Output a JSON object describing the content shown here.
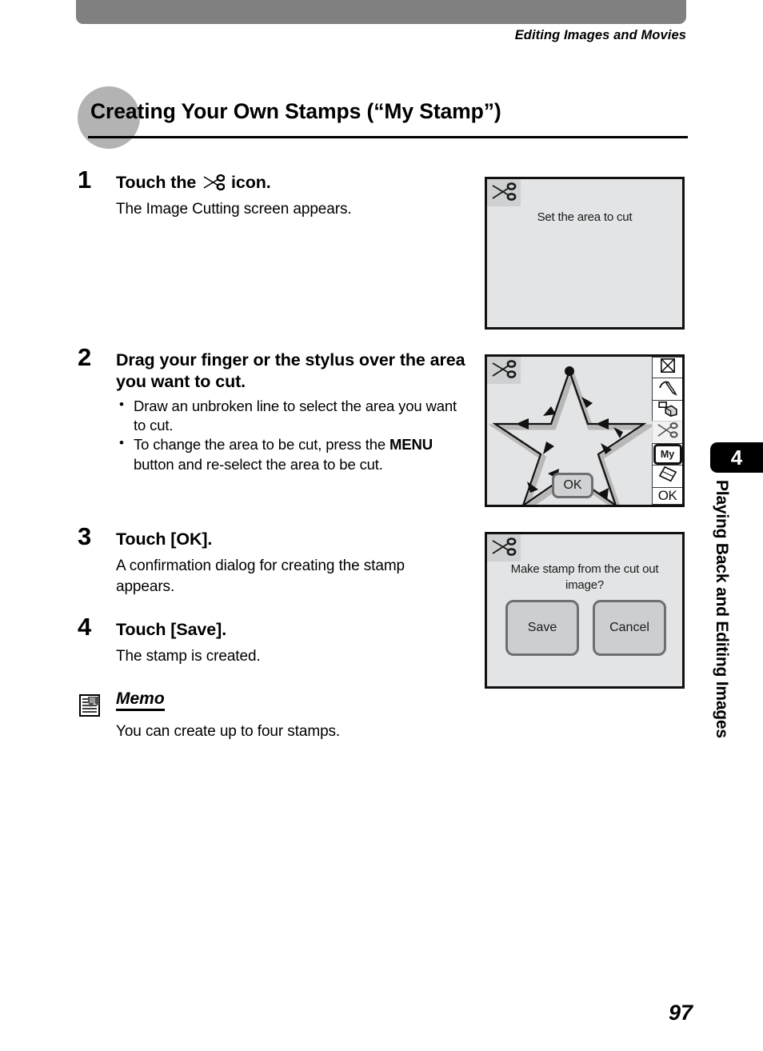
{
  "header": {
    "running_head": "Editing Images and Movies"
  },
  "heading": {
    "title": "Creating Your Own Stamps (“My Stamp”)"
  },
  "steps": [
    {
      "number": "1",
      "title_before_icon": "Touch the",
      "icon": "scissors-icon",
      "title_after_icon": "icon.",
      "body": "The Image Cutting screen appears."
    },
    {
      "number": "2",
      "title": "Drag your finger or the stylus over the area you want to cut.",
      "bullets": [
        "Draw an unbroken line to select the area you want to cut.",
        "To change the area to be cut, press the MENU button and re-select the area to be cut."
      ],
      "bullet2_parts": {
        "pre": "To change the area to be cut, press the ",
        "bold": "MENU",
        "post": " button and re-select the area to be cut."
      }
    },
    {
      "number": "3",
      "title": "Touch [OK].",
      "body": "A confirmation dialog for creating the stamp appears."
    },
    {
      "number": "4",
      "title": "Touch [Save].",
      "body": "The stamp is created."
    }
  ],
  "memo": {
    "icon": "memo-document-icon",
    "title": "Memo",
    "body": "You can create up to four stamps."
  },
  "screens": [
    {
      "name": "image-cutting-screen",
      "badge_icon": "scissors-icon",
      "caption": "Set the area to cut"
    },
    {
      "name": "area-selection-screen",
      "badge_icon": "scissors-icon",
      "ok_button": "OK",
      "toolbar": [
        {
          "name": "cancel-tool",
          "icon": "crossed-box-icon",
          "label": ""
        },
        {
          "name": "pen-tool",
          "icon": "pen-icon",
          "label": ""
        },
        {
          "name": "copy-tool",
          "icon": "shapes-copy-icon",
          "label": ""
        },
        {
          "name": "cut-tool",
          "icon": "scissors-icon",
          "label": "",
          "selected": true
        },
        {
          "name": "my-stamp-tool",
          "icon": "my-badge-icon",
          "label": "My"
        },
        {
          "name": "eraser-tool",
          "icon": "diamond-eraser-icon",
          "label": ""
        },
        {
          "name": "ok-tool",
          "icon": "ok-text-icon",
          "label": "OK"
        }
      ]
    },
    {
      "name": "confirmation-dialog-screen",
      "badge_icon": "scissors-icon",
      "caption": "Make stamp from the cut out image?",
      "save_label": "Save",
      "cancel_label": "Cancel"
    }
  ],
  "side_tab": {
    "chapter_number": "4",
    "chapter_title": "Playing Back and Editing Images"
  },
  "footer": {
    "page_number": "97"
  },
  "colors": {
    "top_bar": "#808080",
    "heading_circle": "#b3b3b3",
    "screen_bg": "#e3e4e5",
    "button_face": "#cdced0",
    "button_border": "#6e6f70"
  }
}
